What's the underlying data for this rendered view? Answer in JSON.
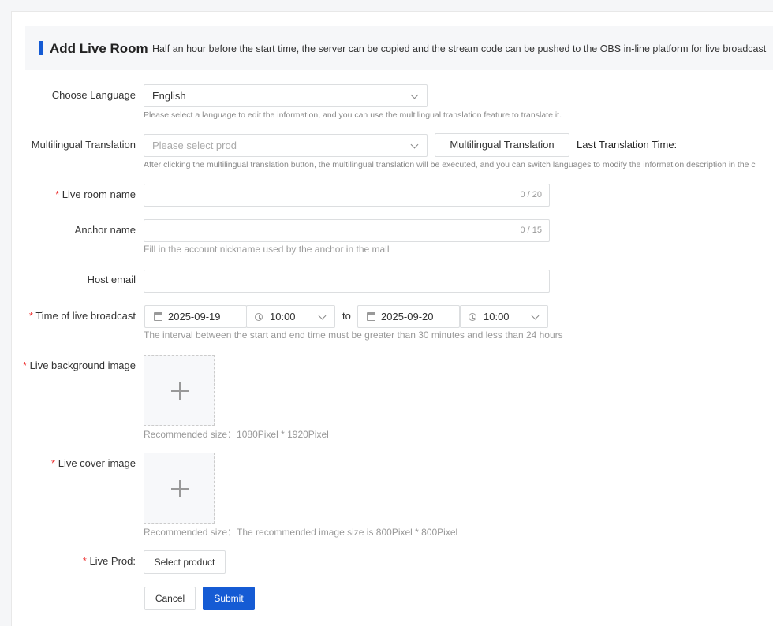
{
  "header": {
    "title": "Add Live Room",
    "description": "Half an hour before the start time, the server can be copied and the stream code can be pushed to the OBS in-line platform for live broadcast"
  },
  "form": {
    "language": {
      "label": "Choose Language",
      "value": "English",
      "hint": "Please select a language to edit the information, and you can use the multilingual translation feature to translate it."
    },
    "translation": {
      "label": "Multilingual Translation",
      "placeholder": "Please select prod",
      "button": "Multilingual Translation",
      "last_time_label": "Last Translation Time:",
      "hint": "After clicking the multilingual translation button, the multilingual translation will be executed, and you can switch languages to modify the information description in the c"
    },
    "room_name": {
      "label": "Live room name",
      "value": "",
      "counter": "0 / 20"
    },
    "anchor_name": {
      "label": "Anchor name",
      "value": "",
      "counter": "0 / 15",
      "hint": "Fill in the account nickname used by the anchor in the mall"
    },
    "host_email": {
      "label": "Host email",
      "value": ""
    },
    "broadcast_time": {
      "label": "Time of live broadcast",
      "start_date": "2025-09-19",
      "start_time": "10:00",
      "separator": "to",
      "end_date": "2025-09-20",
      "end_time": "10:00",
      "hint": "The interval between the start and end time must be greater than 30 minutes and less than 24 hours"
    },
    "background_image": {
      "label": "Live background image",
      "hint": "Recommended size：1080Pixel * 1920Pixel"
    },
    "cover_image": {
      "label": "Live cover image",
      "hint": "Recommended size：The recommended image size is 800Pixel * 800Pixel"
    },
    "live_prod": {
      "label": "Live Prod:",
      "button": "Select product"
    },
    "actions": {
      "cancel": "Cancel",
      "submit": "Submit"
    }
  },
  "colors": {
    "primary": "#155bd4",
    "required": "#ee3333"
  }
}
